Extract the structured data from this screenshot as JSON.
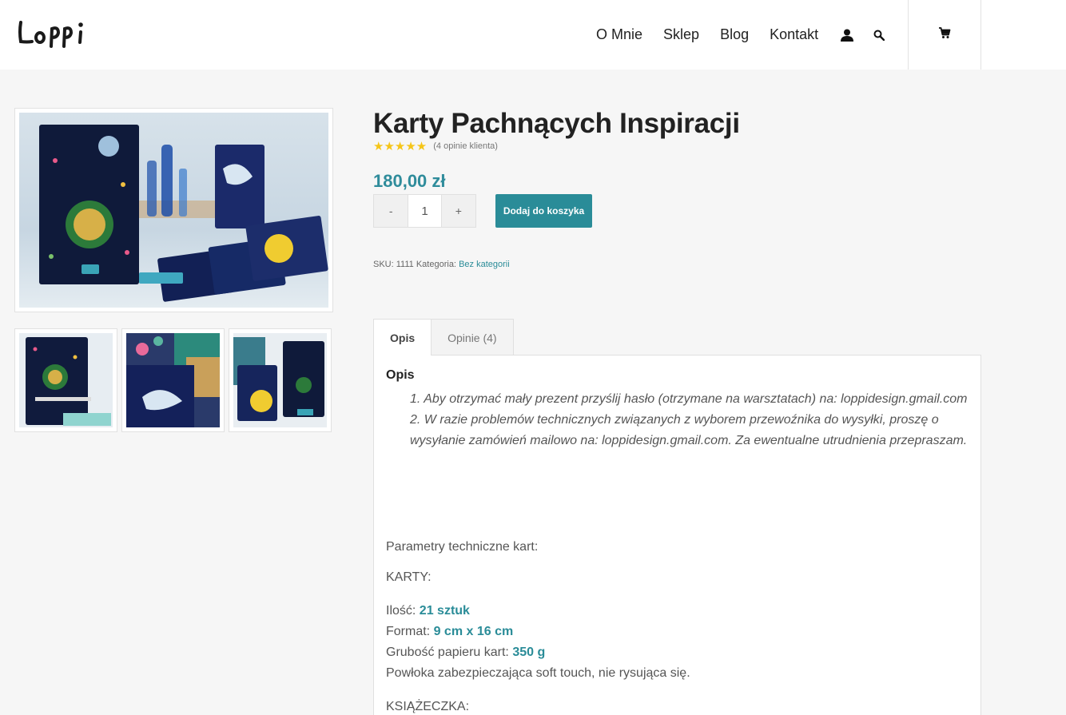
{
  "header": {
    "logo_text": "LoPPi",
    "nav": [
      "O Mnie",
      "Sklep",
      "Blog",
      "Kontakt"
    ]
  },
  "product": {
    "title": "Karty Pachnących Inspiracji",
    "stars": "★★★★★",
    "review_count": "(4 opinie klienta)",
    "price": "180,00 zł",
    "qty_minus": "-",
    "qty_value": "1",
    "qty_plus": "+",
    "add_to_cart": "Dodaj do koszyka",
    "rating_value": 5,
    "meta": {
      "sku_label": "SKU:",
      "sku_value": "1111",
      "category_label": "Kategoria:",
      "category_value": "Bez kategorii"
    }
  },
  "tabs": [
    {
      "label": "Opis"
    },
    {
      "label": "Opinie (4)"
    }
  ],
  "description": {
    "heading": "Opis",
    "items": [
      "1. Aby otrzymać mały prezent przyślij hasło (otrzymane na warsztatach) na: loppidesign.gmail.com",
      "2. W razie problemów technicznych związanych z wyborem przewoźnika do wysyłki, proszę o wysyłanie zamówień mailowo na: loppidesign.gmail.com. Za ewentualne utrudnienia przepraszam."
    ],
    "params_title": "Parametry techniczne kart:",
    "cards_title": "KARTY:",
    "qty_label": "Ilość:",
    "qty_value": "21 sztuk",
    "format_label": "Format:",
    "format_value": "9 cm x 16 cm",
    "paper_label": "Grubość papieru kart:",
    "paper_value": "350 g",
    "coating": "Powłoka zabezpieczająca soft touch, nie rysująca się.",
    "booklet_title": "KSIĄŻECZKA:"
  },
  "colors": {
    "accent": "#2a8c98",
    "star": "#f5c518"
  }
}
